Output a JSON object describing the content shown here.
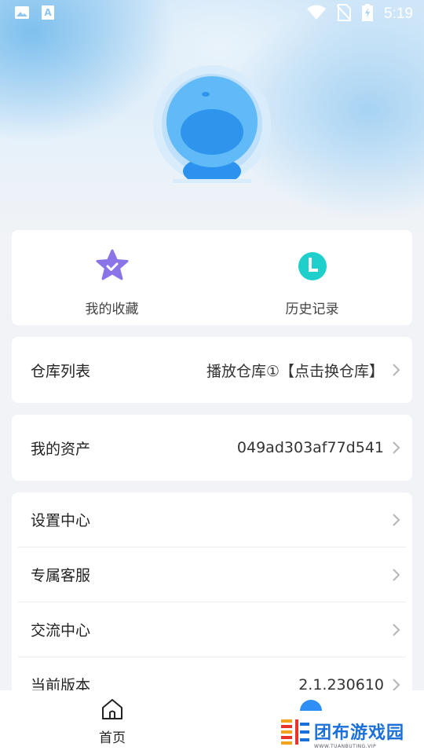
{
  "status_bar": {
    "time": "5:19",
    "icons": [
      "image-icon",
      "keyboard-a-icon",
      "wifi-icon",
      "no-sim-icon",
      "battery-charging-icon"
    ]
  },
  "quick_actions": [
    {
      "label": "我的收藏",
      "icon": "star-icon",
      "color": "#8b73e8"
    },
    {
      "label": "历史记录",
      "icon": "clock-icon",
      "color": "#1fcfcb"
    }
  ],
  "warehouse": {
    "label": "仓库列表",
    "value": "播放仓库①【点击换仓库】"
  },
  "assets": {
    "label": "我的资产",
    "value": "049ad303af77d541"
  },
  "settings": [
    {
      "label": "设置中心",
      "value": ""
    },
    {
      "label": "专属客服",
      "value": ""
    },
    {
      "label": "交流中心",
      "value": ""
    },
    {
      "label": "当前版本",
      "value": "2.1.230610"
    }
  ],
  "bottom_nav": {
    "home_label": "首页"
  },
  "watermark": {
    "title": "团布游戏园",
    "subtitle": "WWW.TUANBUTING.VIP"
  },
  "colors": {
    "accent": "#2f8ef5",
    "avatar_blue": "#4aaaf5"
  }
}
